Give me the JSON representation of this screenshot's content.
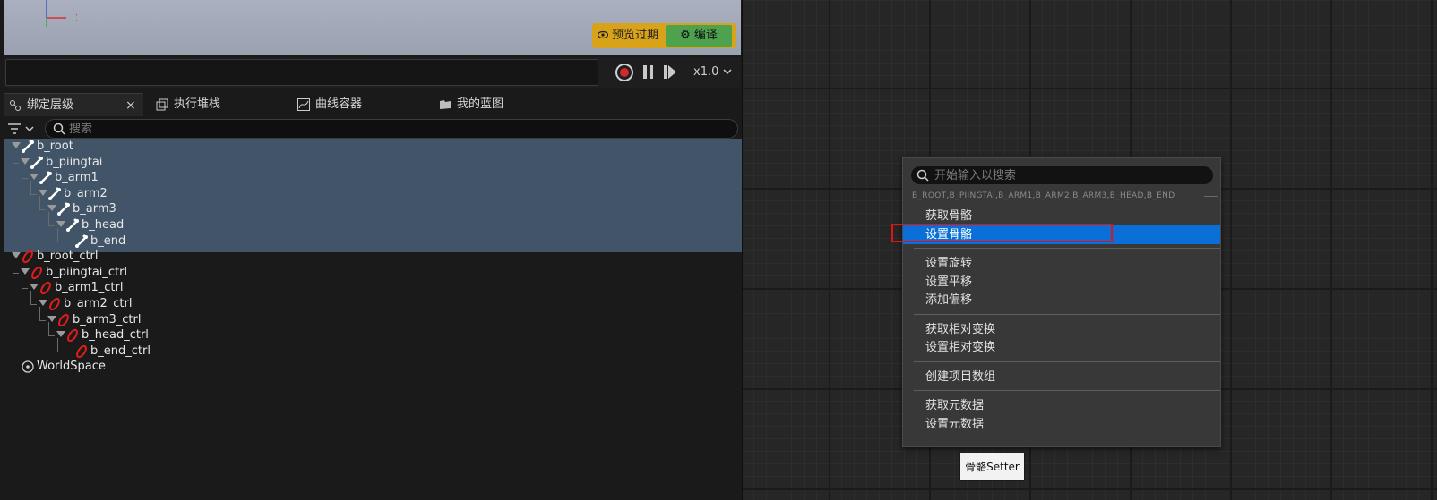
{
  "viewport": {
    "axis_x_label": "X",
    "preview_label": "预览过期",
    "compile_label": "编译",
    "preview_icon": "eye-icon",
    "compile_icon": "gear-icon"
  },
  "timeline": {
    "speed_label": "x1.0",
    "record_icon": "record-icon",
    "pause_icon": "pause-icon",
    "step_icon": "step-forward-icon"
  },
  "tabs": [
    {
      "label": "绑定层级",
      "icon": "rig-hierarchy-icon",
      "active": true,
      "close": "×"
    },
    {
      "label": "执行堆栈",
      "icon": "execution-stack-icon"
    },
    {
      "label": "曲线容器",
      "icon": "curve-container-icon"
    },
    {
      "label": "我的蓝图",
      "icon": "my-blueprint-icon"
    }
  ],
  "hierarchy_search": {
    "placeholder": "搜索"
  },
  "tree": [
    {
      "label": "b_root",
      "depth": 0,
      "kind": "bone",
      "selected": true
    },
    {
      "label": "b_piingtai",
      "depth": 1,
      "kind": "bone",
      "selected": true
    },
    {
      "label": "b_arm1",
      "depth": 2,
      "kind": "bone",
      "selected": true
    },
    {
      "label": "b_arm2",
      "depth": 3,
      "kind": "bone",
      "selected": true
    },
    {
      "label": "b_arm3",
      "depth": 4,
      "kind": "bone",
      "selected": true
    },
    {
      "label": "b_head",
      "depth": 5,
      "kind": "bone",
      "selected": true
    },
    {
      "label": "b_end",
      "depth": 6,
      "kind": "bone",
      "selected": true
    },
    {
      "label": "b_root_ctrl",
      "depth": 0,
      "kind": "control"
    },
    {
      "label": "b_piingtai_ctrl",
      "depth": 1,
      "kind": "control"
    },
    {
      "label": "b_arm1_ctrl",
      "depth": 2,
      "kind": "control"
    },
    {
      "label": "b_arm2_ctrl",
      "depth": 3,
      "kind": "control"
    },
    {
      "label": "b_arm3_ctrl",
      "depth": 4,
      "kind": "control"
    },
    {
      "label": "b_head_ctrl",
      "depth": 5,
      "kind": "control"
    },
    {
      "label": "b_end_ctrl",
      "depth": 6,
      "kind": "control"
    },
    {
      "label": "WorldSpace",
      "depth": 0,
      "kind": "space"
    }
  ],
  "context_menu": {
    "search_placeholder": "开始输入以搜索",
    "category": "B_ROOT,B_PIINGTAI,B_ARM1,B_ARM2,B_ARM3,B_HEAD,B_END",
    "groups": [
      [
        "获取骨骼",
        "设置骨骼"
      ],
      [
        "设置旋转",
        "设置平移",
        "添加偏移"
      ],
      [
        "获取相对变换",
        "设置相对变换"
      ],
      [
        "创建项目数组"
      ],
      [
        "获取元数据",
        "设置元数据"
      ]
    ],
    "selected_item": "设置骨骼"
  },
  "tooltip": {
    "label": "骨骼Setter"
  },
  "colors": {
    "selection": "#415468",
    "menu_selected": "#0a70d7",
    "compile_green": "#4ea24e",
    "preview_yellow": "#d9a21b",
    "highlight_red": "#e01414",
    "control_red": "#e01c1c"
  }
}
